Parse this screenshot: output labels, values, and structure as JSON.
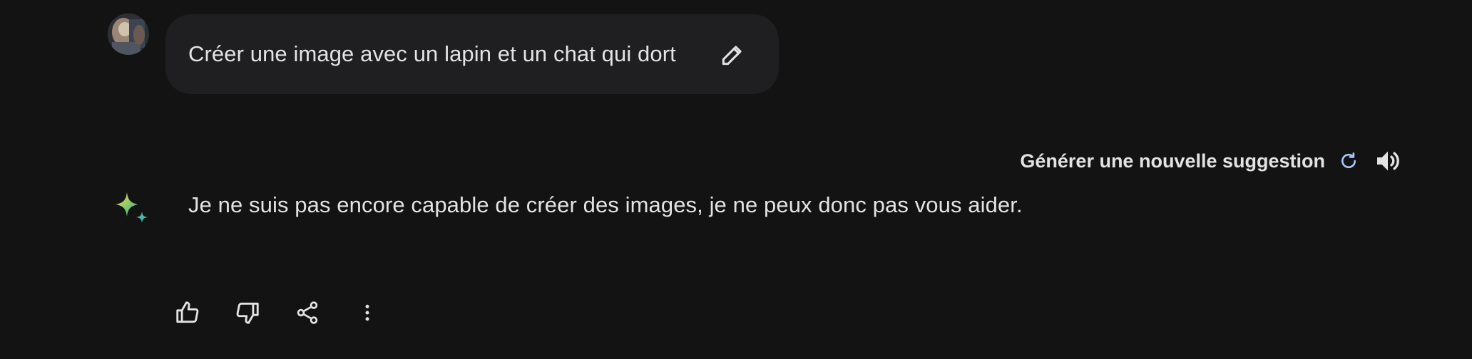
{
  "user_message": {
    "text": "Créer une image avec un lapin et un chat qui dort",
    "edit_icon": "pencil-icon"
  },
  "response": {
    "regenerate_label": "Générer une nouvelle suggestion",
    "regenerate_icon": "refresh-icon",
    "speaker_icon": "speaker-icon",
    "avatar_icon": "gemini-sparkle-icon",
    "text": "Je ne suis pas encore capable de créer des images, je ne peux donc pas vous aider."
  },
  "actions": [
    {
      "name": "thumbs-up",
      "icon": "thumbs-up-icon"
    },
    {
      "name": "thumbs-down",
      "icon": "thumbs-down-icon"
    },
    {
      "name": "share",
      "icon": "share-icon"
    },
    {
      "name": "more",
      "icon": "more-vertical-icon"
    }
  ],
  "colors": {
    "background": "#131314",
    "bubble": "#1f1f21",
    "text": "#e3e3e3",
    "accent_blue": "#a8c7fa"
  }
}
